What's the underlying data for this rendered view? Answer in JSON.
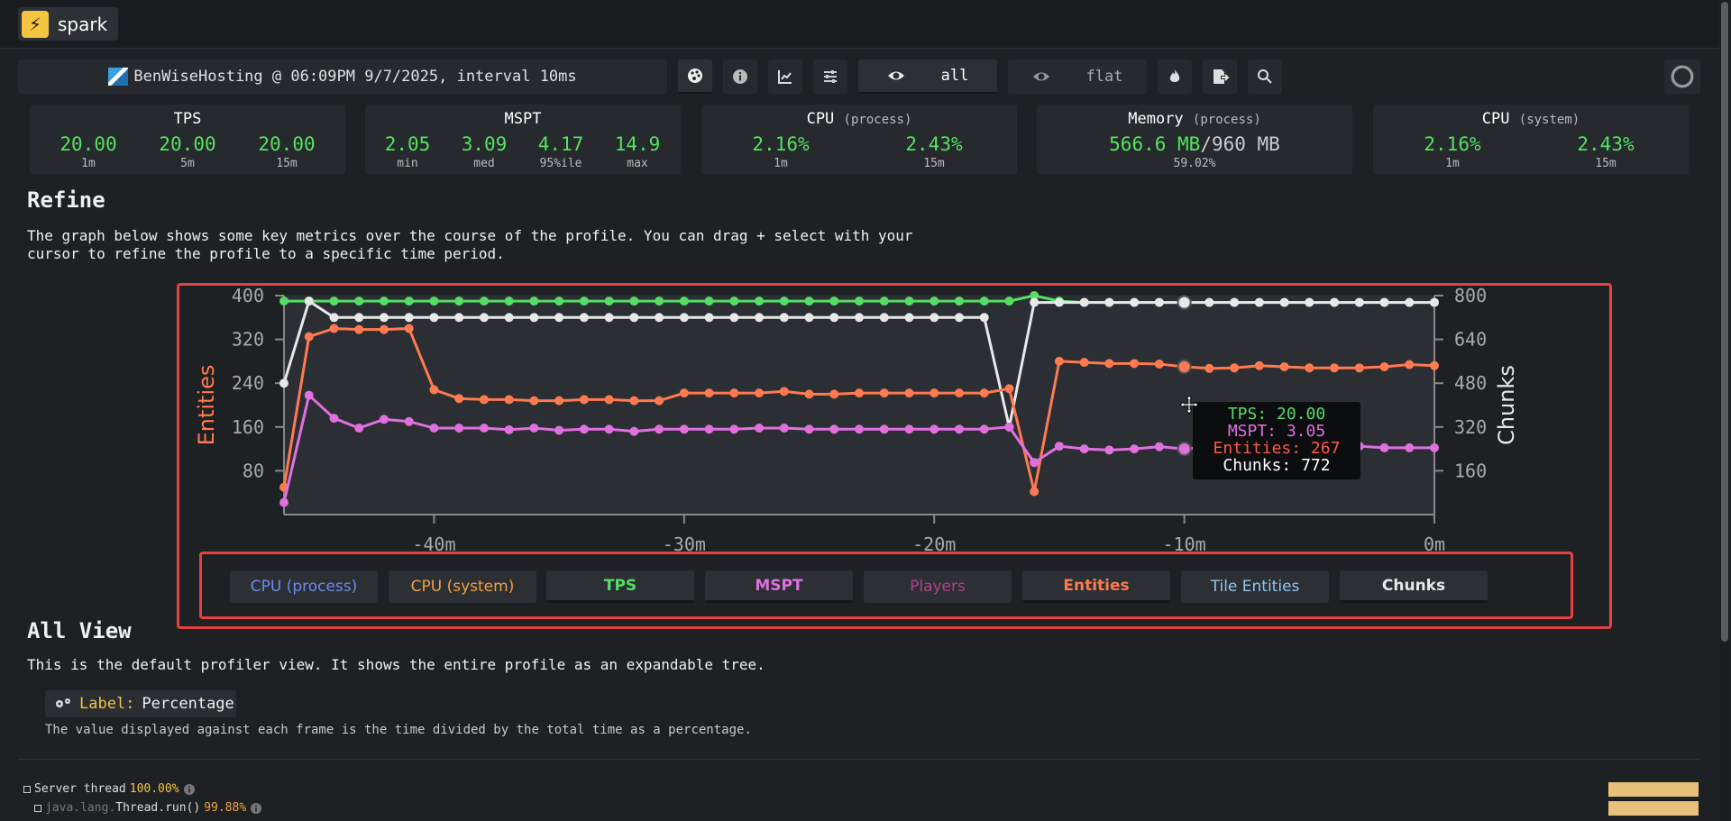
{
  "app": {
    "name": "spark",
    "logo_glyph": "⚡"
  },
  "toolbar": {
    "info_text": "BenWiseHosting @ 06:09PM 9/7/2025, interval 10ms",
    "view_all_label": "all",
    "view_flat_label": "flat"
  },
  "stats": {
    "tps": {
      "title": "TPS",
      "values": [
        "20.00",
        "20.00",
        "20.00"
      ],
      "labels": [
        "1m",
        "5m",
        "15m"
      ]
    },
    "mspt": {
      "title": "MSPT",
      "values": [
        "2.05",
        "3.09",
        "4.17",
        "14.9"
      ],
      "labels": [
        "min",
        "med",
        "95%ile",
        "max"
      ]
    },
    "cpu_process": {
      "title": "CPU",
      "sub": "(process)",
      "values": [
        "2.16%",
        "2.43%"
      ],
      "labels": [
        "1m",
        "15m"
      ]
    },
    "memory": {
      "title": "Memory",
      "sub": "(process)",
      "used": "566.6 MB",
      "sep": "/",
      "total": "960 MB",
      "pct": "59.02%"
    },
    "cpu_system": {
      "title": "CPU",
      "sub": "(system)",
      "values": [
        "2.16%",
        "2.43%"
      ],
      "labels": [
        "1m",
        "15m"
      ]
    }
  },
  "refine": {
    "heading": "Refine",
    "description_line1": "The graph below shows some key metrics over the course of the profile. You can drag + select with your",
    "description_line2": "cursor to refine the profile to a specific time period."
  },
  "chart_data": {
    "type": "line",
    "left_axis": {
      "label": "Entities",
      "ticks": [
        "400",
        "320",
        "240",
        "160",
        "80"
      ],
      "range": [
        0,
        400
      ]
    },
    "right_axis": {
      "label": "Chunks",
      "ticks": [
        "800",
        "640",
        "480",
        "320",
        "160"
      ],
      "range": [
        0,
        800
      ]
    },
    "x_ticks": [
      "-40m",
      "-30m",
      "-20m",
      "-10m",
      "0m"
    ],
    "x_range": [
      -46,
      0
    ],
    "x": [
      -46,
      -45,
      -44,
      -43,
      -42,
      -41,
      -40,
      -39,
      -38,
      -37,
      -36,
      -35,
      -34,
      -33,
      -32,
      -31,
      -30,
      -29,
      -28,
      -27,
      -26,
      -25,
      -24,
      -23,
      -22,
      -21,
      -20,
      -19,
      -18,
      -17,
      -16,
      -15,
      -14,
      -13,
      -12,
      -11,
      -10,
      -9,
      -8,
      -7,
      -6,
      -5,
      -4,
      -3,
      -2,
      -1,
      0
    ],
    "series": [
      {
        "name": "TPS",
        "color": "#55dd66",
        "axis": "right",
        "values": [
          780,
          780,
          780,
          780,
          780,
          780,
          780,
          780,
          780,
          780,
          780,
          780,
          780,
          780,
          780,
          780,
          780,
          780,
          780,
          780,
          780,
          780,
          780,
          780,
          780,
          780,
          780,
          780,
          780,
          780,
          800,
          780,
          775,
          775,
          775,
          775,
          775,
          775,
          775,
          775,
          775,
          775,
          775,
          775,
          775,
          775,
          775
        ]
      },
      {
        "name": "Chunks",
        "color": "#e8e8e8",
        "axis": "right",
        "values": [
          480,
          780,
          720,
          720,
          720,
          720,
          720,
          720,
          720,
          720,
          720,
          720,
          720,
          720,
          720,
          720,
          720,
          720,
          720,
          720,
          720,
          720,
          720,
          720,
          720,
          720,
          720,
          720,
          720,
          320,
          775,
          775,
          775,
          775,
          775,
          775,
          775,
          775,
          775,
          775,
          775,
          775,
          775,
          775,
          775,
          775,
          775
        ]
      },
      {
        "name": "Entities",
        "color": "#ff7a50",
        "axis": "left",
        "values": [
          50,
          325,
          340,
          338,
          338,
          340,
          228,
          212,
          210,
          210,
          208,
          208,
          210,
          210,
          208,
          208,
          222,
          222,
          222,
          222,
          225,
          220,
          220,
          222,
          222,
          222,
          222,
          222,
          222,
          230,
          42,
          280,
          278,
          276,
          276,
          275,
          270,
          267,
          268,
          272,
          270,
          268,
          268,
          268,
          270,
          274,
          272
        ]
      },
      {
        "name": "MSPT",
        "color": "#e070e0",
        "axis": "left",
        "values": [
          22,
          218,
          176,
          158,
          174,
          170,
          158,
          158,
          158,
          155,
          158,
          154,
          156,
          156,
          152,
          156,
          156,
          156,
          156,
          158,
          158,
          156,
          156,
          156,
          156,
          156,
          156,
          156,
          156,
          160,
          95,
          125,
          120,
          118,
          120,
          124,
          120,
          123,
          122,
          124,
          125,
          126,
          127,
          125,
          122,
          122,
          122
        ]
      }
    ],
    "tooltip": {
      "tps": "TPS: 20.00",
      "mspt": "MSPT: 3.05",
      "entities": "Entities: 267",
      "chunks": "Chunks: 772"
    }
  },
  "legend": [
    {
      "label": "CPU (process)",
      "color": "#6a8cf0",
      "active": false
    },
    {
      "label": "CPU (system)",
      "color": "#f0a040",
      "active": false
    },
    {
      "label": "TPS",
      "color": "#55dd66",
      "active": true
    },
    {
      "label": "MSPT",
      "color": "#e070e0",
      "active": true
    },
    {
      "label": "Players",
      "color": "#b0408a",
      "active": false
    },
    {
      "label": "Entities",
      "color": "#ff7a50",
      "active": true
    },
    {
      "label": "Tile Entities",
      "color": "#8ec8f0",
      "active": false
    },
    {
      "label": "Chunks",
      "color": "#e8e8e8",
      "active": true
    }
  ],
  "all_view": {
    "heading": "All View",
    "description": "This is the default profiler view. It shows the entire profile as an expandable tree.",
    "label_prefix": "Label:",
    "label_value": "Percentage",
    "small_desc": "The value displayed against each frame is the time divided by the total time as a percentage."
  },
  "tree": [
    {
      "name": "Server thread",
      "pct": "100.00%"
    },
    {
      "pkg": "java.lang.",
      "name": "Thread.run()",
      "pct": "99.88%"
    }
  ]
}
